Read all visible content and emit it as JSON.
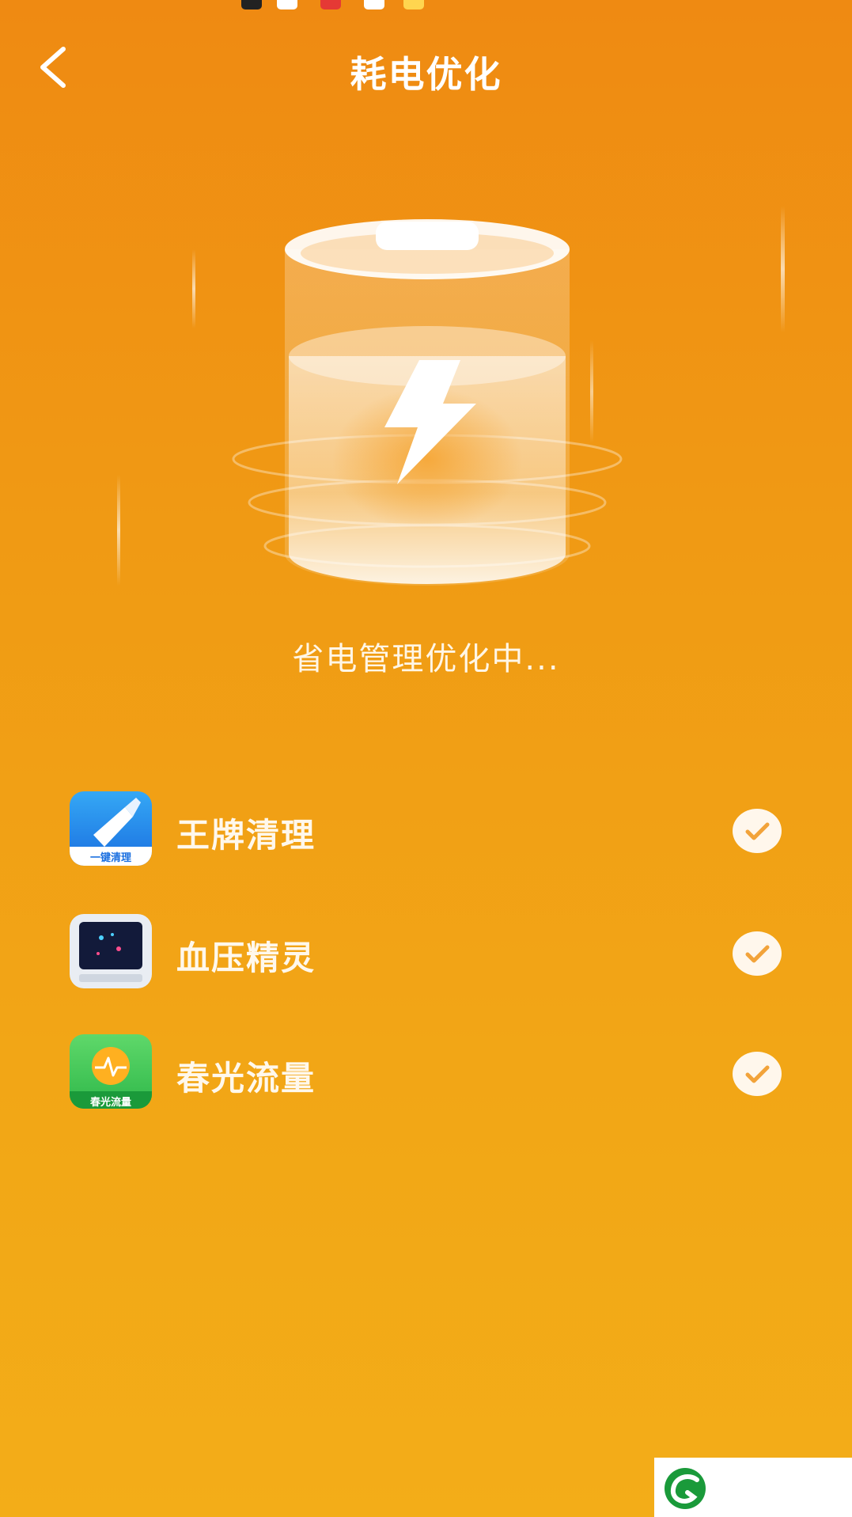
{
  "header": {
    "title": "耗电优化"
  },
  "status": {
    "text": "省电管理优化中..."
  },
  "apps": [
    {
      "name": "王牌清理",
      "icon": "broom-icon",
      "icon_caption": "一键清理",
      "checked": true
    },
    {
      "name": "血压精灵",
      "icon": "monitor-icon",
      "checked": true
    },
    {
      "name": "春光流量",
      "icon": "sun-pulse-icon",
      "icon_caption": "春光流量",
      "checked": true
    }
  ],
  "icons": {
    "back": "chevron-left-icon",
    "battery": "battery-charging-icon",
    "check": "check-icon",
    "logo": "leaf-logo-icon"
  },
  "colors": {
    "bg_top": "#ef8a12",
    "bg_bottom": "#f3ad18",
    "accent_green": "#1a9a3a"
  }
}
